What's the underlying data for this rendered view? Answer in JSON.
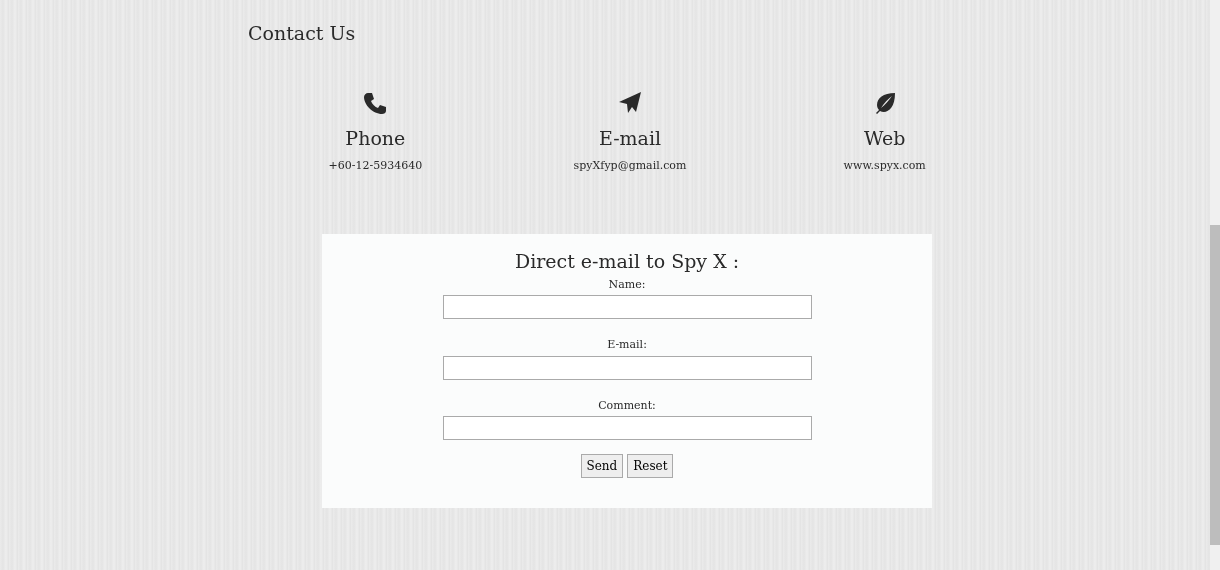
{
  "heading": "Contact Us",
  "contacts": [
    {
      "kind": "phone",
      "title": "Phone",
      "value": "+60-12-5934640"
    },
    {
      "kind": "email",
      "title": "E-mail",
      "value": "spyXfyp@gmail.com"
    },
    {
      "kind": "web",
      "title": "Web",
      "value": "www.spyx.com"
    }
  ],
  "form": {
    "title": "Direct e-mail to Spy X :",
    "fields": [
      {
        "label": "Name:"
      },
      {
        "label": "E-mail:"
      },
      {
        "label": "Comment:"
      }
    ],
    "buttons": [
      "Send",
      "Reset"
    ]
  }
}
